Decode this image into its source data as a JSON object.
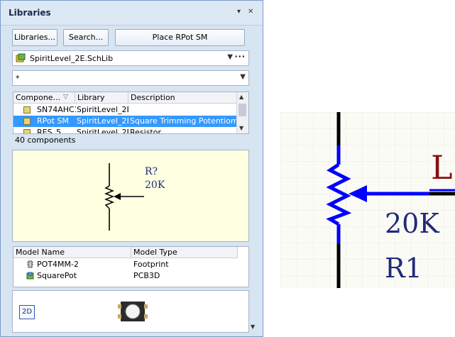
{
  "panel": {
    "title": "Libraries",
    "pin_glyph": "▾",
    "close_glyph": "✕"
  },
  "toolbar": {
    "libraries_label": "Libraries...",
    "search_label": "Search...",
    "place_label": "Place RPot SM"
  },
  "library_select": {
    "value": "SpiritLevel_2E.SchLib",
    "more_glyph": "···"
  },
  "filter": {
    "value": "*"
  },
  "component_list": {
    "columns": [
      "Compone...",
      "Library",
      "Description"
    ],
    "rows": [
      {
        "name": "SN74AHC1",
        "library": "SpiritLevel_2E.",
        "description": ""
      },
      {
        "name": "RPot SM",
        "library": "SpiritLevel_2E.",
        "description": "Square Trimming Potentiome"
      },
      {
        "name": "RES_5",
        "library": "SpiritLevel_2E.",
        "description": "Resistor"
      }
    ],
    "selected_index": 1
  },
  "component_count": "40 components",
  "preview": {
    "designator": "R?",
    "value": "20K"
  },
  "models": {
    "columns": [
      "Model Name",
      "Model Type"
    ],
    "rows": [
      {
        "name": "POT4MM-2",
        "type": "Footprint"
      },
      {
        "name": "SquarePot",
        "type": "PCB3D"
      }
    ]
  },
  "view3d": {
    "mode_label": "2D"
  },
  "zoom": {
    "value": "20K",
    "designator": "R1",
    "partial_letter": "L"
  },
  "colors": {
    "wire": "#0000ff",
    "pin": "#000000",
    "text": "#1f2a7a",
    "selection": "#3399ff"
  }
}
